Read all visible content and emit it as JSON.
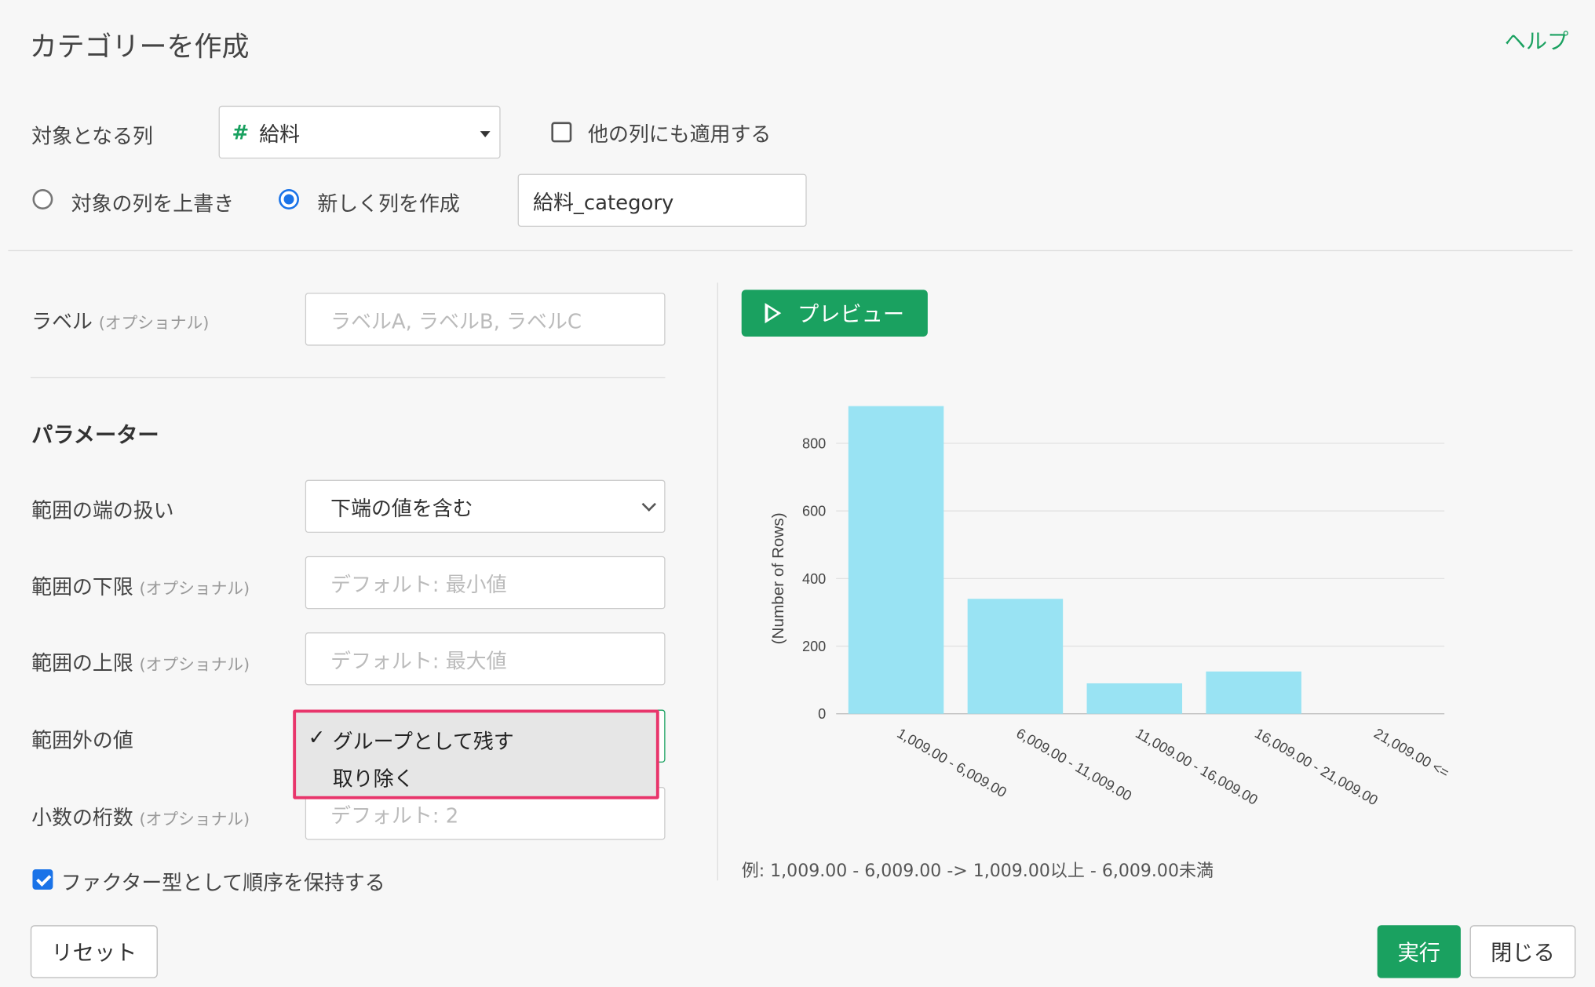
{
  "dialog": {
    "title": "カテゴリーを作成",
    "help": "ヘルプ"
  },
  "target": {
    "label": "対象となる列",
    "column_icon": "#",
    "column_value": "給料",
    "apply_others_label": "他の列にも適用する",
    "apply_others_checked": false
  },
  "mode": {
    "overwrite_label": "対象の列を上書き",
    "new_label": "新しく列を作成",
    "selected": "new",
    "new_column_name": "給料_category"
  },
  "label_field": {
    "label": "ラベル",
    "optional": "(オプショナル)",
    "placeholder": "ラベルA, ラベルB, ラベルC"
  },
  "params": {
    "heading": "パラメーター",
    "edge": {
      "label": "範囲の端の扱い",
      "value": "下端の値を含む"
    },
    "lower": {
      "label": "範囲の下限",
      "optional": "(オプショナル)",
      "placeholder": "デフォルト: 最小値"
    },
    "upper": {
      "label": "範囲の上限",
      "optional": "(オプショナル)",
      "placeholder": "デフォルト: 最大値"
    },
    "outside": {
      "label": "範囲外の値",
      "options": [
        "グループとして残す",
        "取り除く"
      ],
      "selected_index": 0
    },
    "decimals": {
      "label": "小数の桁数",
      "optional": "(オプショナル)",
      "placeholder": "デフォルト: 2"
    },
    "factor": {
      "label": "ファクター型として順序を保持する",
      "checked": true
    }
  },
  "preview": {
    "button": "プレビュー",
    "note": "例: 1,009.00 - 6,009.00 -> 1,009.00以上 - 6,009.00未満"
  },
  "chart_data": {
    "type": "bar",
    "categories": [
      "1,009.00 - 6,009.00",
      "6,009.00 - 11,009.00",
      "11,009.00 - 16,009.00",
      "16,009.00 - 21,009.00",
      "21,009.00 <="
    ],
    "values": [
      910,
      340,
      90,
      125,
      0
    ],
    "ylabel": "(Number of Rows)",
    "yticks": [
      0,
      200,
      400,
      600,
      800
    ],
    "ylim": [
      0,
      800
    ],
    "grid": true,
    "bar_color": "#99e3f3"
  },
  "footer": {
    "reset": "リセット",
    "run": "実行",
    "close": "閉じる"
  },
  "colors": {
    "accent": "#1aa160",
    "highlight": "#e8356b",
    "radio": "#1a73e8"
  }
}
